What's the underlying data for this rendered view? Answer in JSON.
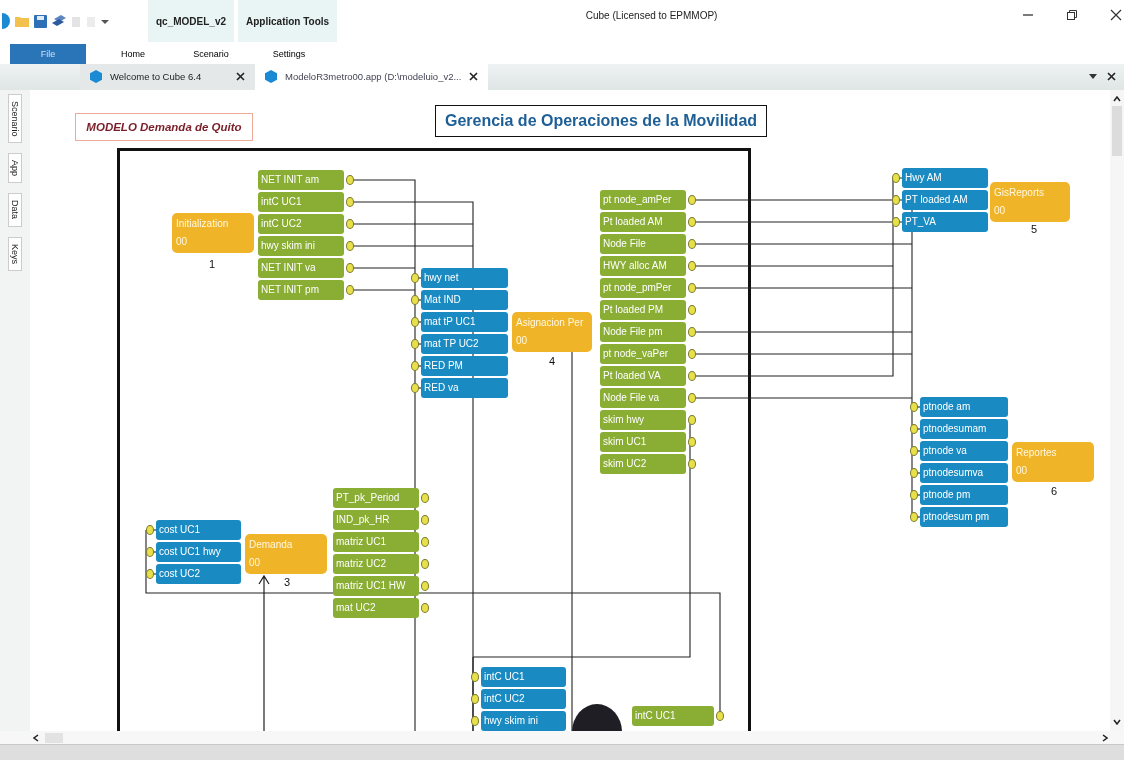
{
  "window": {
    "title": "Cube (Licensed to EPMMOP)",
    "context_tabs": [
      {
        "label": "qc_MODEL_v2"
      },
      {
        "label": "Application Tools"
      }
    ]
  },
  "ribbon_tabs": [
    {
      "label": "File",
      "selected": true
    },
    {
      "label": "Home",
      "selected": false
    },
    {
      "label": "Scenario",
      "selected": false
    },
    {
      "label": "Settings",
      "selected": false
    }
  ],
  "document_tabs": [
    {
      "label": "Welcome to Cube 6.4",
      "selected": false
    },
    {
      "label": "ModeloR3metro00.app (D:\\modeluio_v2...",
      "selected": true
    }
  ],
  "side_tabs": [
    {
      "label": "Scenario"
    },
    {
      "label": "App"
    },
    {
      "label": "Data"
    },
    {
      "label": "Keys"
    }
  ],
  "canvas": {
    "model_label": "MODELO Demanda de Quito",
    "heading": "Gerencia de Operaciones de la Movilidad",
    "programs": [
      {
        "name": "Initialization",
        "code": "00",
        "number": "1"
      },
      {
        "name": "Asignacion Per",
        "code": "00",
        "number": "4"
      },
      {
        "name": "GisReports",
        "code": "00",
        "number": "5"
      },
      {
        "name": "Reportes",
        "code": "00",
        "number": "6"
      },
      {
        "name": "Demanda",
        "code": "00",
        "number": "3"
      }
    ],
    "data_groups": [
      {
        "kind": "output",
        "items": [
          "NET INIT am",
          "intC UC1",
          "intC UC2",
          "hwy skim ini",
          "NET INIT va",
          "NET INIT pm"
        ]
      },
      {
        "kind": "input",
        "items": [
          "hwy net",
          "Mat IND",
          "mat tP UC1",
          "mat TP UC2",
          "RED PM",
          "RED va"
        ]
      },
      {
        "kind": "output",
        "items": [
          "pt node_amPer",
          "Pt loaded AM",
          "Node File",
          "HWY alloc AM",
          "pt node_pmPer",
          "Pt loaded PM",
          "Node File pm",
          "pt node_vaPer",
          "Pt loaded VA",
          "Node File va",
          "skim hwy",
          "skim UC1",
          "skim UC2"
        ]
      },
      {
        "kind": "input",
        "items": [
          "Hwy AM",
          "PT loaded AM",
          "PT_VA"
        ]
      },
      {
        "kind": "input",
        "items": [
          "ptnode am",
          "ptnodesumam",
          "ptnode va",
          "ptnodesumva",
          "ptnode pm",
          "ptnodesum pm"
        ]
      },
      {
        "kind": "input",
        "items": [
          "cost UC1",
          "cost UC1 hwy",
          "cost UC2"
        ]
      },
      {
        "kind": "output",
        "items": [
          "PT_pk_Period",
          "IND_pk_HR",
          "matriz UC1",
          "matriz UC2",
          "matriz UC1 HW",
          "mat UC2"
        ]
      },
      {
        "kind": "input",
        "items": [
          "intC UC1",
          "intC UC2",
          "hwy skim ini"
        ]
      },
      {
        "kind": "output",
        "items": [
          "intC UC1"
        ]
      }
    ]
  }
}
